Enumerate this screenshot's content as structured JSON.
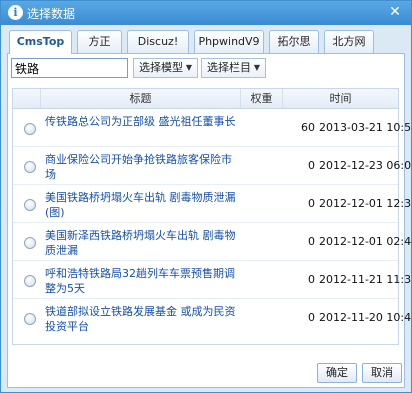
{
  "window": {
    "title": "选择数据",
    "close_glyph": "✕"
  },
  "tabs": [
    {
      "label": "CmsTop",
      "active": true
    },
    {
      "label": "方正",
      "active": false
    },
    {
      "label": "Discuz!",
      "active": false
    },
    {
      "label": "PhpwindV9",
      "active": false
    },
    {
      "label": "拓尔思",
      "active": false
    },
    {
      "label": "北方网",
      "active": false
    }
  ],
  "filters": {
    "search_value": "铁路",
    "model_label": "选择模型",
    "column_label": "选择栏目"
  },
  "table": {
    "headers": {
      "title": "标题",
      "weight": "权重",
      "time": "时间"
    },
    "rows": [
      {
        "title": "传铁路总公司为正部级 盛光祖任董事长",
        "weight": "60",
        "time": "2013-03-21 10:57"
      },
      {
        "title": "商业保险公司开始争抢铁路旅客保险市场",
        "weight": "0",
        "time": "2012-12-23 06:02"
      },
      {
        "title": "美国铁路桥坍塌火车出轨 剧毒物质泄漏(图)",
        "weight": "0",
        "time": "2012-12-01 12:38"
      },
      {
        "title": "美国新泽西铁路桥坍塌火车出轨 剧毒物质泄漏",
        "weight": "0",
        "time": "2012-12-01 02:44"
      },
      {
        "title": "呼和浩特铁路局32趟列车车票预售期调整为5天",
        "weight": "0",
        "time": "2012-11-21 11:38"
      },
      {
        "title": "铁道部拟设立铁路发展基金 或成为民资投资平台",
        "weight": "0",
        "time": "2012-11-20 10:42"
      }
    ]
  },
  "buttons": {
    "confirm": "确定",
    "cancel": "取消"
  },
  "colors": {
    "titlebar": "#3a8bd3",
    "link": "#1650a8",
    "border": "#9dbfe0"
  }
}
